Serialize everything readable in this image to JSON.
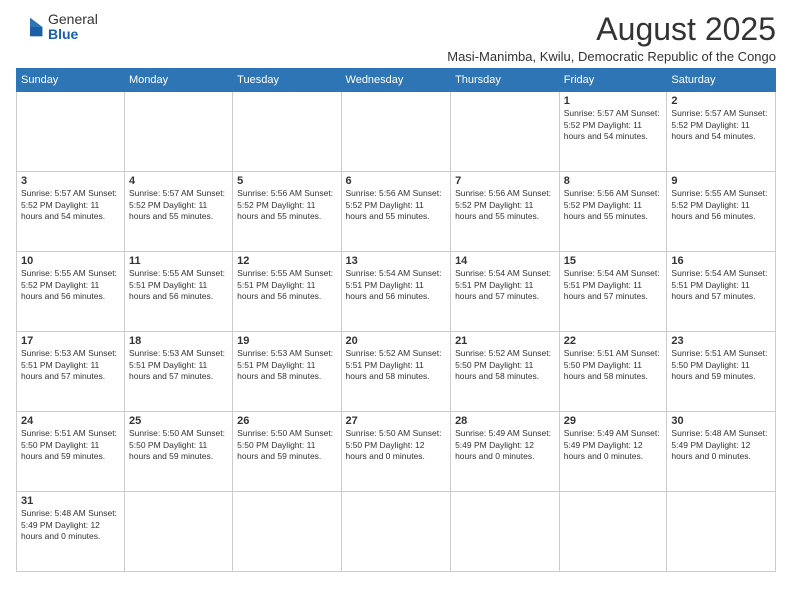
{
  "header": {
    "logo_general": "General",
    "logo_blue": "Blue",
    "month_year": "August 2025",
    "location": "Masi-Manimba, Kwilu, Democratic Republic of the Congo"
  },
  "weekdays": [
    "Sunday",
    "Monday",
    "Tuesday",
    "Wednesday",
    "Thursday",
    "Friday",
    "Saturday"
  ],
  "weeks": [
    [
      {
        "day": "",
        "info": ""
      },
      {
        "day": "",
        "info": ""
      },
      {
        "day": "",
        "info": ""
      },
      {
        "day": "",
        "info": ""
      },
      {
        "day": "",
        "info": ""
      },
      {
        "day": "1",
        "info": "Sunrise: 5:57 AM\nSunset: 5:52 PM\nDaylight: 11 hours\nand 54 minutes."
      },
      {
        "day": "2",
        "info": "Sunrise: 5:57 AM\nSunset: 5:52 PM\nDaylight: 11 hours\nand 54 minutes."
      }
    ],
    [
      {
        "day": "3",
        "info": "Sunrise: 5:57 AM\nSunset: 5:52 PM\nDaylight: 11 hours\nand 54 minutes."
      },
      {
        "day": "4",
        "info": "Sunrise: 5:57 AM\nSunset: 5:52 PM\nDaylight: 11 hours\nand 55 minutes."
      },
      {
        "day": "5",
        "info": "Sunrise: 5:56 AM\nSunset: 5:52 PM\nDaylight: 11 hours\nand 55 minutes."
      },
      {
        "day": "6",
        "info": "Sunrise: 5:56 AM\nSunset: 5:52 PM\nDaylight: 11 hours\nand 55 minutes."
      },
      {
        "day": "7",
        "info": "Sunrise: 5:56 AM\nSunset: 5:52 PM\nDaylight: 11 hours\nand 55 minutes."
      },
      {
        "day": "8",
        "info": "Sunrise: 5:56 AM\nSunset: 5:52 PM\nDaylight: 11 hours\nand 55 minutes."
      },
      {
        "day": "9",
        "info": "Sunrise: 5:55 AM\nSunset: 5:52 PM\nDaylight: 11 hours\nand 56 minutes."
      }
    ],
    [
      {
        "day": "10",
        "info": "Sunrise: 5:55 AM\nSunset: 5:52 PM\nDaylight: 11 hours\nand 56 minutes."
      },
      {
        "day": "11",
        "info": "Sunrise: 5:55 AM\nSunset: 5:51 PM\nDaylight: 11 hours\nand 56 minutes."
      },
      {
        "day": "12",
        "info": "Sunrise: 5:55 AM\nSunset: 5:51 PM\nDaylight: 11 hours\nand 56 minutes."
      },
      {
        "day": "13",
        "info": "Sunrise: 5:54 AM\nSunset: 5:51 PM\nDaylight: 11 hours\nand 56 minutes."
      },
      {
        "day": "14",
        "info": "Sunrise: 5:54 AM\nSunset: 5:51 PM\nDaylight: 11 hours\nand 57 minutes."
      },
      {
        "day": "15",
        "info": "Sunrise: 5:54 AM\nSunset: 5:51 PM\nDaylight: 11 hours\nand 57 minutes."
      },
      {
        "day": "16",
        "info": "Sunrise: 5:54 AM\nSunset: 5:51 PM\nDaylight: 11 hours\nand 57 minutes."
      }
    ],
    [
      {
        "day": "17",
        "info": "Sunrise: 5:53 AM\nSunset: 5:51 PM\nDaylight: 11 hours\nand 57 minutes."
      },
      {
        "day": "18",
        "info": "Sunrise: 5:53 AM\nSunset: 5:51 PM\nDaylight: 11 hours\nand 57 minutes."
      },
      {
        "day": "19",
        "info": "Sunrise: 5:53 AM\nSunset: 5:51 PM\nDaylight: 11 hours\nand 58 minutes."
      },
      {
        "day": "20",
        "info": "Sunrise: 5:52 AM\nSunset: 5:51 PM\nDaylight: 11 hours\nand 58 minutes."
      },
      {
        "day": "21",
        "info": "Sunrise: 5:52 AM\nSunset: 5:50 PM\nDaylight: 11 hours\nand 58 minutes."
      },
      {
        "day": "22",
        "info": "Sunrise: 5:51 AM\nSunset: 5:50 PM\nDaylight: 11 hours\nand 58 minutes."
      },
      {
        "day": "23",
        "info": "Sunrise: 5:51 AM\nSunset: 5:50 PM\nDaylight: 11 hours\nand 59 minutes."
      }
    ],
    [
      {
        "day": "24",
        "info": "Sunrise: 5:51 AM\nSunset: 5:50 PM\nDaylight: 11 hours\nand 59 minutes."
      },
      {
        "day": "25",
        "info": "Sunrise: 5:50 AM\nSunset: 5:50 PM\nDaylight: 11 hours\nand 59 minutes."
      },
      {
        "day": "26",
        "info": "Sunrise: 5:50 AM\nSunset: 5:50 PM\nDaylight: 11 hours\nand 59 minutes."
      },
      {
        "day": "27",
        "info": "Sunrise: 5:50 AM\nSunset: 5:50 PM\nDaylight: 12 hours\nand 0 minutes."
      },
      {
        "day": "28",
        "info": "Sunrise: 5:49 AM\nSunset: 5:49 PM\nDaylight: 12 hours\nand 0 minutes."
      },
      {
        "day": "29",
        "info": "Sunrise: 5:49 AM\nSunset: 5:49 PM\nDaylight: 12 hours\nand 0 minutes."
      },
      {
        "day": "30",
        "info": "Sunrise: 5:48 AM\nSunset: 5:49 PM\nDaylight: 12 hours\nand 0 minutes."
      }
    ],
    [
      {
        "day": "31",
        "info": "Sunrise: 5:48 AM\nSunset: 5:49 PM\nDaylight: 12 hours\nand 0 minutes."
      },
      {
        "day": "",
        "info": ""
      },
      {
        "day": "",
        "info": ""
      },
      {
        "day": "",
        "info": ""
      },
      {
        "day": "",
        "info": ""
      },
      {
        "day": "",
        "info": ""
      },
      {
        "day": "",
        "info": ""
      }
    ]
  ]
}
